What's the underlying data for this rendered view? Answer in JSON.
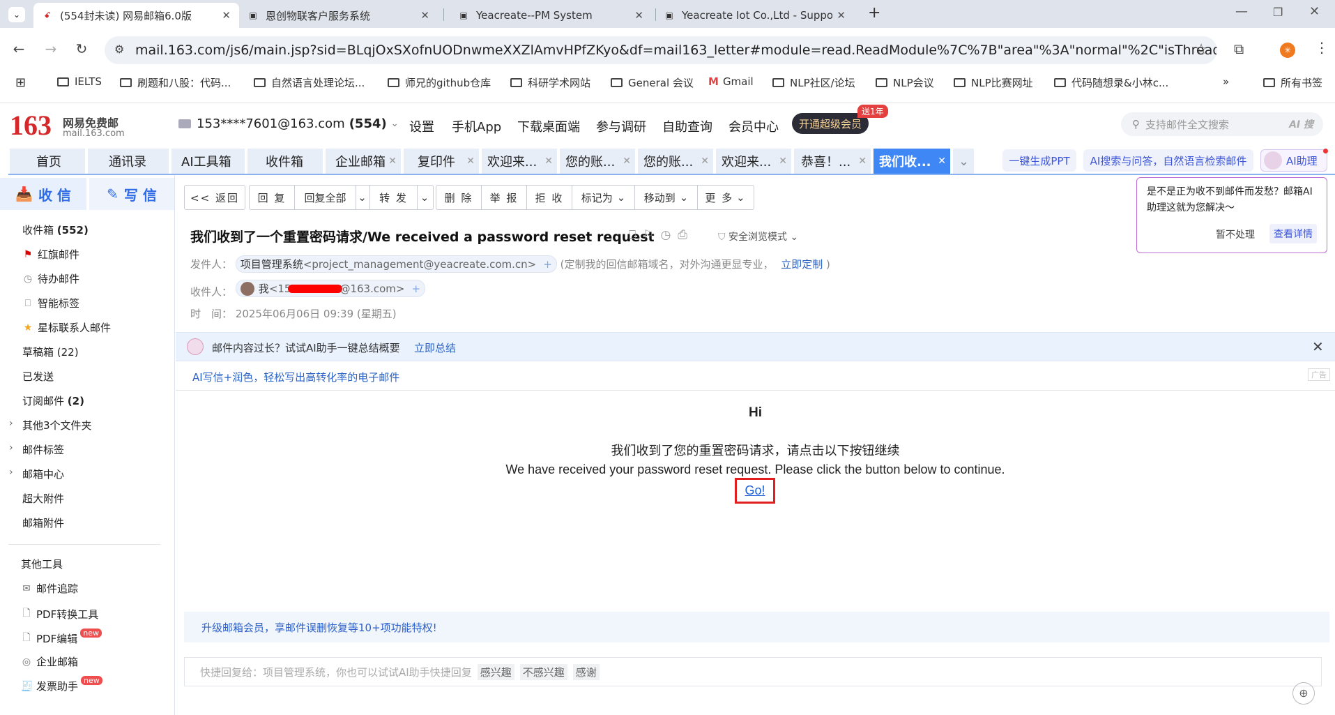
{
  "browser": {
    "tabs": [
      {
        "title": "(554封未读) 网易邮箱6.0版",
        "active": true
      },
      {
        "title": "恩创物联客户服务系统"
      },
      {
        "title": "Yeacreate--PM System"
      },
      {
        "title": "Yeacreate Iot Co.,Ltd - Suppo"
      }
    ],
    "url": "mail.163.com/js6/main.jsp?sid=BLqjOxSXofnUODnwmeXXZlAmvHPfZKyo&df=mail163_letter#module=read.ReadModule%7C%7B\"area\"%3A\"normal\"%2C\"isThread\"%3Afalse%2...",
    "bookmarks": [
      "IELTS",
      "刷题和八股：代码...",
      "自然语言处理论坛...",
      "师兄的github仓库",
      "科研学术网站",
      "General 会议",
      "Gmail",
      "NLP社区/论坛",
      "NLP会议",
      "NLP比赛网址",
      "代码随想录&小林c..."
    ],
    "all_bookmarks": "所有书签"
  },
  "mail": {
    "logo_num": "163",
    "logo_text": "网易免费邮",
    "logo_url": "mail.163.com",
    "account": "153****7601@163.com",
    "account_count": "(554)",
    "topnav": [
      "设置",
      "手机App",
      "下载桌面端",
      "参与调研",
      "自助查询",
      "会员中心"
    ],
    "vip_btn": "开通超级会员",
    "vip_badge": "送1年",
    "search_placeholder": "支持邮件全文搜索",
    "search_ai": "AI 搜",
    "tabs": [
      "首页",
      "通讯录",
      "AI工具箱",
      "收件箱",
      "企业邮箱",
      "复印件",
      "欢迎来...",
      "您的账...",
      "您的账...",
      "欢迎来...",
      "恭喜！...",
      "我们收..."
    ],
    "pills": [
      "一键生成PPT",
      "AI搜索与问答，自然语言检索邮件",
      "AI助理"
    ],
    "recv": "收 信",
    "write": "写 信",
    "folders": {
      "inbox": "收件箱",
      "inbox_count": "(552)",
      "red": "红旗邮件",
      "todo": "待办邮件",
      "smart": "智能标签",
      "star": "星标联系人邮件",
      "draft": "草稿箱 (22)",
      "sent": "已发送",
      "sub": "订阅邮件",
      "sub_count": "(2)",
      "other3": "其他3个文件夹",
      "labels": "邮件标签",
      "center": "邮箱中心",
      "big": "超大附件",
      "attach": "邮箱附件"
    },
    "tools": {
      "title": "其他工具",
      "track": "邮件追踪",
      "pdfconv": "PDF转换工具",
      "pdfedit": "PDF编辑",
      "ent": "企业邮箱",
      "invoice": "发票助手",
      "new": "new"
    },
    "toolbar": [
      "<< 返回",
      "回 复",
      "回复全部",
      "转 发",
      "删 除",
      "举 报",
      "拒 收",
      "标记为",
      "移动到",
      "更 多"
    ],
    "subject": "我们收到了一个重置密码请求/We received a password reset request",
    "safe_mode": "安全浏览模式",
    "from_label": "发件人：",
    "from_name": "项目管理系统",
    "from_email": "<project_management@yeacreate.com.cn>",
    "from_note": "(定制我的回信邮箱域名，对外沟通更显专业，",
    "from_link": "立即定制",
    "from_close": ")",
    "to_label": "收件人：",
    "to_name": "我",
    "to_email_a": "<15",
    "to_email_b": "@163.com>",
    "time_label": "时　间：",
    "time": "2025年06月06日 09:39 (星期五)",
    "ai_tip": "邮件内容过长？试试AI助手一键总结概要",
    "ai_link": "立即总结",
    "ad": "AI写信+润色，轻松写出高转化率的电子邮件",
    "ad_tag": "广告",
    "body_hi": "Hi",
    "body_cn": "我们收到了您的重置密码请求，请点击以下按钮继续",
    "body_en": "We have received your password reset request. Please click the button below to continue.",
    "go": "Go!",
    "upgrade": "升级邮箱会员，享邮件误删恢复等10+项功能特权!",
    "quick_placeholder": "快捷回复给：项目管理系统，你也可以试试AI助手快捷回复",
    "quick_tags": [
      "感兴趣",
      "不感兴趣",
      "感谢"
    ],
    "popup_text": "是不是正为收不到邮件而发愁？邮箱AI助理这就为您解决～",
    "popup_ignore": "暂不处理",
    "popup_view": "查看详情"
  }
}
